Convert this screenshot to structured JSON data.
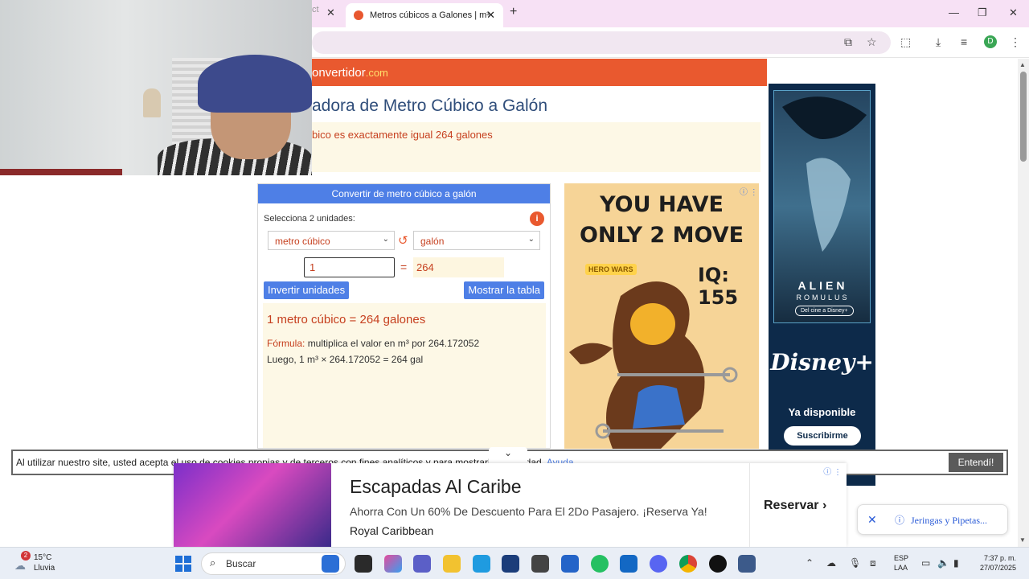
{
  "browser": {
    "prev_tab": {
      "label": "ct"
    },
    "active_tab": {
      "title": "Metros cúbicos a Galones | m³"
    },
    "new_tab_label": "+",
    "window_controls": {
      "minimize": "—",
      "maximize": "❐",
      "close": "✕"
    },
    "profile_initial": "D"
  },
  "page": {
    "site_name": "onvertidor",
    "site_domain": ".com",
    "title": "adora de Metro Cúbico a Galón",
    "summary": "bico es exactamente igual 264 galones"
  },
  "converter": {
    "header": "Convertir de metro cúbico a galón",
    "select_label": "Selecciona 2 unidades:",
    "info_icon": "i",
    "from_unit": "metro cúbico",
    "to_unit": "galón",
    "swap_icon": "↺",
    "input_value": "1",
    "equals": "=",
    "result_value": "264",
    "invert_button": "Invertir unidades",
    "table_button": "Mostrar la tabla",
    "result_line": "1 metro cúbico = 264 galones",
    "formula_label": "Fórmula:",
    "formula_text": "multiplica el valor en m³ por 264.172052",
    "luego_text": "Luego, 1 m³ × 264.172052 = 264 gal"
  },
  "ads": {
    "game": {
      "line1": "YOU HAVE",
      "line2": "ONLY 2 MOVE",
      "iq": "IQ: 155",
      "brand": "HERO WARS",
      "adchoice": "ⓘ ⋮"
    },
    "alien": {
      "title": "ALIEN",
      "subtitle": "ROMULUS",
      "tag": "Del cine a Disney+",
      "brand": "Disney+",
      "available": "Ya disponible",
      "cta": "Suscribirme"
    },
    "bottom": {
      "headline": "Escapadas Al Caribe",
      "description": "Ahorra Con Un 60% De Descuento Para El 2Do Pasajero. ¡Reserva Ya!",
      "sponsor": "Royal Caribbean",
      "cta": "Reservar",
      "adchoice": "ⓘ ⋮"
    },
    "side_pill": {
      "close": "✕",
      "text": "Jeringas y Pipetas..."
    }
  },
  "cookie": {
    "text": "Al utilizar nuestro site, usted acepta el uso de cookies propias y de terceros con fines analíticos y para mostrarle publicidad.",
    "help": "Ayuda",
    "ok_button": "Entendí!"
  },
  "taskbar": {
    "weather": {
      "temp": "15°C",
      "condition": "Lluvia",
      "badge": "2"
    },
    "search_placeholder": "Buscar",
    "language": {
      "code": "ESP",
      "layout": "LAA"
    },
    "clock": {
      "time": "7:37 p. m.",
      "date": "27/07/2025"
    }
  },
  "colors": {
    "accent_orange": "#e9592f",
    "accent_blue": "#4e7fe6",
    "result_red": "#c6401f"
  }
}
